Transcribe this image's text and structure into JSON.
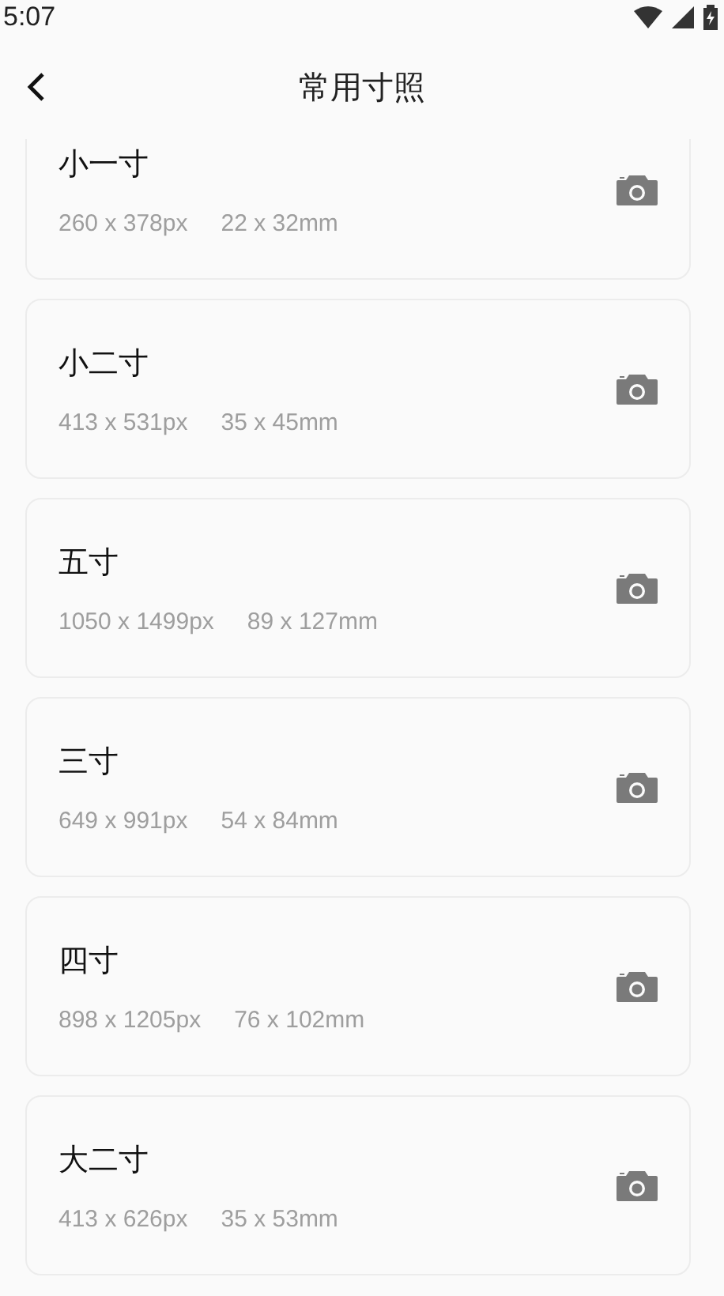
{
  "status_bar": {
    "time": "5:07"
  },
  "header": {
    "title": "常用寸照"
  },
  "sizes": [
    {
      "name": "小一寸",
      "pixels": "260 x 378px",
      "millimeters": "22 x 32mm"
    },
    {
      "name": "小二寸",
      "pixels": "413 x 531px",
      "millimeters": "35 x 45mm"
    },
    {
      "name": "五寸",
      "pixels": "1050 x 1499px",
      "millimeters": "89 x 127mm"
    },
    {
      "name": "三寸",
      "pixels": "649 x 991px",
      "millimeters": "54 x 84mm"
    },
    {
      "name": "四寸",
      "pixels": "898 x 1205px",
      "millimeters": "76 x 102mm"
    },
    {
      "name": "大二寸",
      "pixels": "413 x 626px",
      "millimeters": "35 x 53mm"
    }
  ]
}
